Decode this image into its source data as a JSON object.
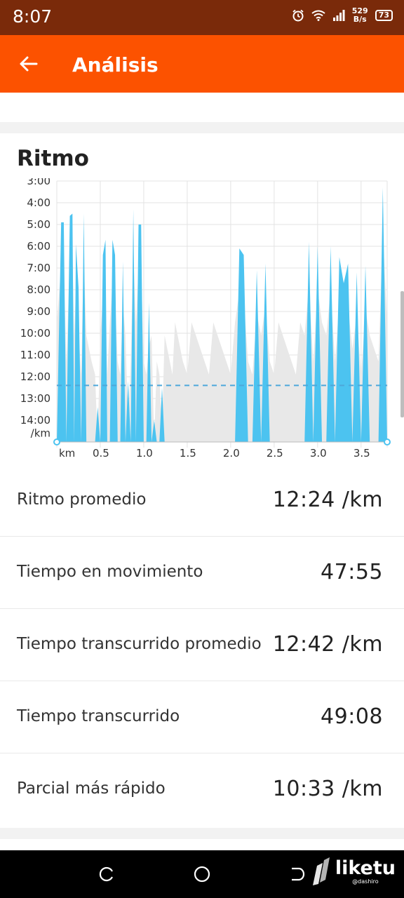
{
  "status_bar": {
    "time": "8:07",
    "net_speed_value": "529",
    "net_speed_unit": "B/s",
    "battery": "73"
  },
  "app_bar": {
    "title": "Análisis"
  },
  "section": {
    "title": "Ritmo"
  },
  "chart_data": {
    "type": "area",
    "title": "",
    "xlabel": "km",
    "ylabel": "/km",
    "y_inverted": true,
    "y_ticks": [
      "3:00",
      "4:00",
      "5:00",
      "6:00",
      "7:00",
      "8:00",
      "9:00",
      "10:00",
      "11:00",
      "12:00",
      "13:00",
      "14:00"
    ],
    "y_unit_label": "/km",
    "x_ticks": [
      "km",
      "0.5",
      "1.0",
      "1.5",
      "2.0",
      "2.5",
      "3.0",
      "3.5"
    ],
    "x_range": [
      0,
      3.8
    ],
    "y_range_minutes": [
      3,
      15
    ],
    "average_pace_minutes": 12.4,
    "grid": true,
    "colors": {
      "pace": "#4cc3f0",
      "grade": "#e8e8e8",
      "average_line": "#4da8da"
    },
    "series": [
      {
        "name": "",
        "x": [
          0.0,
          0.05,
          0.08,
          0.11,
          0.15,
          0.18,
          0.2,
          0.22,
          0.25,
          0.28,
          0.31,
          0.34,
          0.37,
          0.4,
          0.44,
          0.47,
          0.5,
          0.53,
          0.56,
          0.58,
          0.61,
          0.64,
          0.67,
          0.7,
          0.73,
          0.76,
          0.79,
          0.82,
          0.85,
          0.88,
          0.91,
          0.94,
          0.97,
          1.0,
          1.03,
          1.06,
          1.09,
          1.12,
          1.15,
          1.18,
          1.21,
          1.24,
          1.27,
          1.3,
          1.33,
          1.36,
          1.39,
          1.42,
          1.45,
          1.5,
          1.55,
          1.6,
          1.65,
          1.7,
          1.75,
          1.8,
          1.85,
          1.9,
          1.95,
          2.0,
          2.05,
          2.1,
          2.15,
          2.2,
          2.25,
          2.3,
          2.35,
          2.4,
          2.45,
          2.5,
          2.55,
          2.6,
          2.65,
          2.7,
          2.75,
          2.8,
          2.85,
          2.9,
          2.95,
          3.0,
          3.05,
          3.1,
          3.15,
          3.2,
          3.25,
          3.3,
          3.35,
          3.4,
          3.45,
          3.5,
          3.55,
          3.6,
          3.65,
          3.7,
          3.75,
          3.8
        ],
        "y": [
          15,
          4.9,
          4.9,
          15,
          4.6,
          4.5,
          15,
          5.9,
          7.9,
          15,
          4.5,
          15,
          15,
          15,
          15,
          13.4,
          15,
          6.4,
          5.7,
          15,
          15,
          5.7,
          6.4,
          15,
          15,
          6.7,
          15,
          12.2,
          15,
          4.3,
          15,
          5.0,
          5.0,
          15,
          15,
          8.6,
          15,
          14.0,
          15,
          15,
          12.5,
          15,
          15,
          15,
          15,
          15,
          15,
          15,
          15,
          15,
          15,
          15,
          15,
          15,
          15,
          15,
          15,
          15,
          15,
          15,
          15,
          6.1,
          6.4,
          15,
          15,
          7.1,
          15,
          6.8,
          15,
          15,
          15,
          15,
          15,
          15,
          15,
          15,
          15,
          5.8,
          15,
          6.0,
          15,
          15,
          6.0,
          15,
          6.5,
          7.7,
          6.8,
          15,
          7.2,
          15,
          6.9,
          15,
          15,
          15,
          3.3,
          15
        ]
      }
    ]
  },
  "stats": [
    {
      "label": "Ritmo promedio",
      "value": "12:24 /km"
    },
    {
      "label": "Tiempo en movimiento",
      "value": "47:55"
    },
    {
      "label": "Tiempo transcurrido promedio",
      "value": "12:42 /km"
    },
    {
      "label": "Tiempo transcurrido",
      "value": "49:08"
    },
    {
      "label": "Parcial más rápido",
      "value": "10:33 /km"
    }
  ],
  "watermark": {
    "brand": "liketu",
    "user": "@dashiro"
  }
}
